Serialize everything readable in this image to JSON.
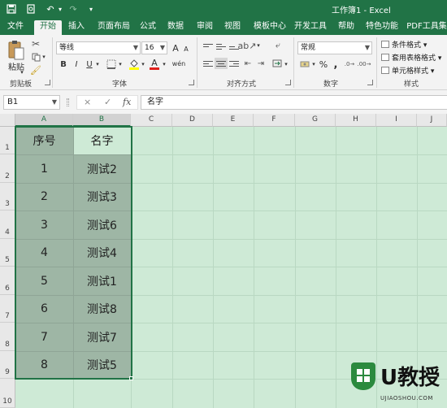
{
  "window": {
    "title": "工作簿1 - Excel",
    "quick_access": [
      "save-icon",
      "print-preview-icon",
      "undo-icon",
      "redo-icon",
      "customize-qat-icon"
    ]
  },
  "ribbon_tabs": [
    "文件",
    "开始",
    "插入",
    "页面布局",
    "公式",
    "数据",
    "审阅",
    "视图",
    "模板中心",
    "开发工具",
    "帮助",
    "特色功能",
    "PDF工具集"
  ],
  "active_tab": "开始",
  "ribbon": {
    "clipboard": {
      "paste_label": "粘贴",
      "group_label": "剪贴板"
    },
    "font": {
      "font_name": "等线",
      "font_size": "16",
      "bold": "B",
      "italic": "I",
      "underline": "U",
      "font_color_glyph": "A",
      "grow": "A",
      "shrink": "A",
      "wen": "wén",
      "group_label": "字体"
    },
    "alignment": {
      "group_label": "对齐方式"
    },
    "number": {
      "format": "常规",
      "percent": "%",
      "comma": ",",
      "group_label": "数字"
    },
    "styles": {
      "conditional": "条件格式",
      "table": "套用表格格式",
      "cell": "单元格样式",
      "group_label": "样式"
    }
  },
  "formula_bar": {
    "name_box": "B1",
    "cancel": "×",
    "enter": "✓",
    "fx": "fx",
    "content": "名字"
  },
  "columns": [
    "A",
    "B",
    "C",
    "D",
    "E",
    "F",
    "G",
    "H",
    "I",
    "J"
  ],
  "rows": [
    "1",
    "2",
    "3",
    "4",
    "5",
    "6",
    "7",
    "8",
    "9",
    "10"
  ],
  "table": {
    "headers": [
      "序号",
      "名字"
    ],
    "rows": [
      [
        "1",
        "测试2"
      ],
      [
        "2",
        "测试3"
      ],
      [
        "3",
        "测试6"
      ],
      [
        "4",
        "测试4"
      ],
      [
        "5",
        "测试1"
      ],
      [
        "6",
        "测试8"
      ],
      [
        "7",
        "测试7"
      ],
      [
        "8",
        "测试5"
      ]
    ]
  },
  "colors": {
    "excel_green": "#217346",
    "grid_bg": "#ceead6",
    "selection_fill": "#9eb6a5"
  },
  "watermark": {
    "brand": "U教授",
    "sub": "UJIAOSHOU.COM"
  }
}
